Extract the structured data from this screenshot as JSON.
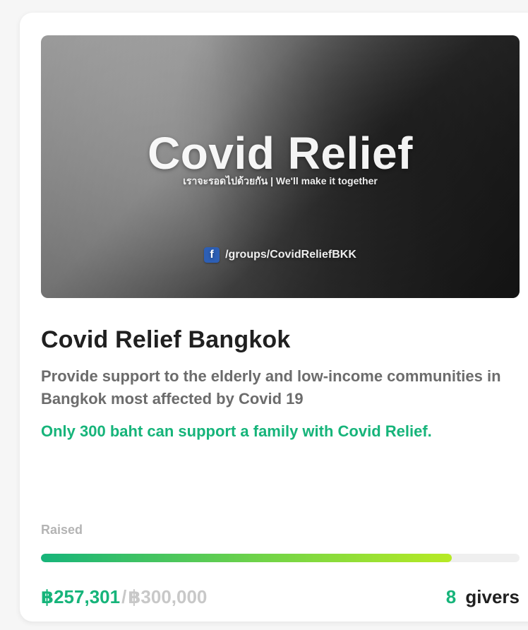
{
  "hero": {
    "title": "Covid Relief",
    "subtitle": "เราจะรอดไปด้วยกัน | We'll make it together",
    "link_text": "/groups/CovidReliefBKK",
    "facebook_icon": "facebook-icon",
    "facebook_letter": "f"
  },
  "campaign": {
    "title": "Covid Relief Bangkok",
    "description": "Provide support to the elderly and low-income communities in Bangkok most affected by Covid 19",
    "highlight": "Only 300 baht can support a family with Covid Relief."
  },
  "funding": {
    "raised_label": "Raised",
    "raised_amount": "฿257,301",
    "slash": "/",
    "goal_amount": "฿300,000",
    "progress_percent": 85.8,
    "givers_count": "8",
    "givers_label": "givers"
  },
  "colors": {
    "accent": "#16b47a",
    "muted": "#c8c8c8",
    "text": "#202020"
  }
}
